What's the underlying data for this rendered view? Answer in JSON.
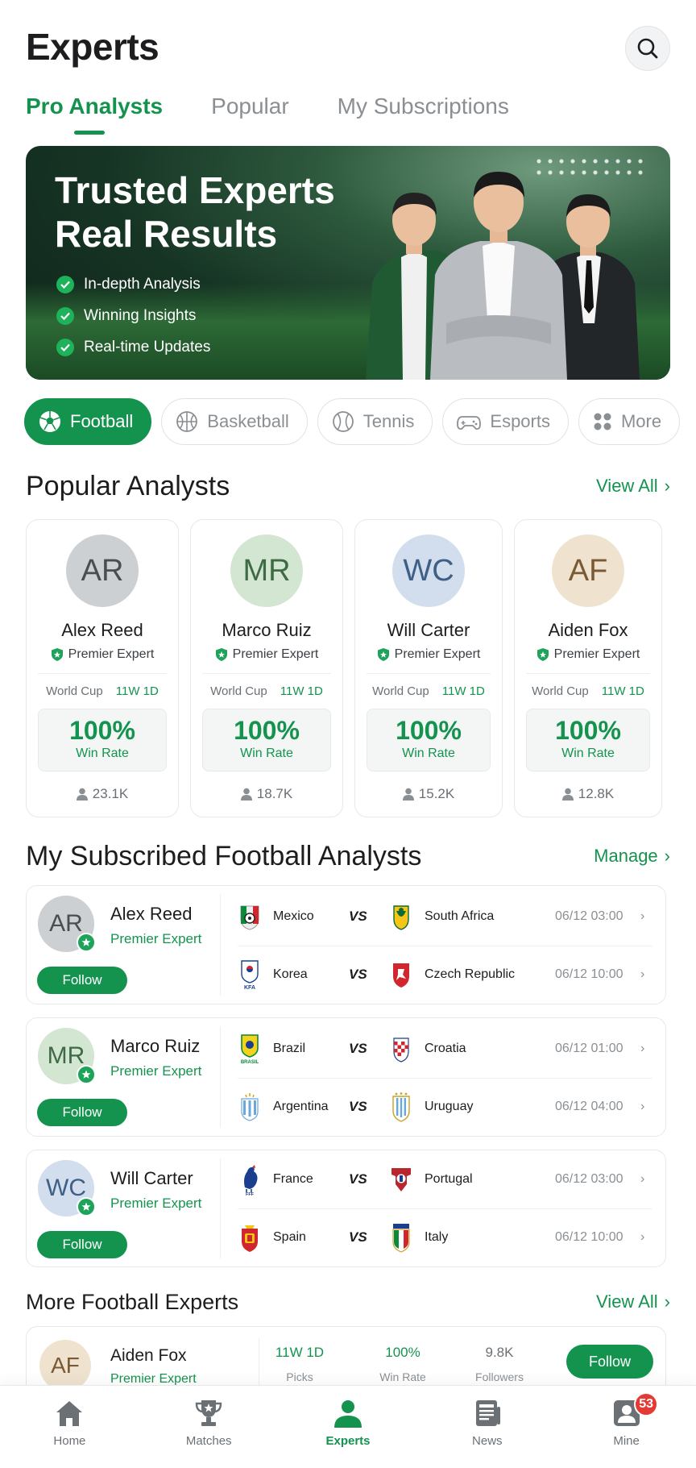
{
  "header": {
    "title": "Experts"
  },
  "tabs": [
    {
      "label": "Pro Analysts",
      "active": true
    },
    {
      "label": "Popular",
      "active": false
    },
    {
      "label": "My Subscriptions",
      "active": false
    }
  ],
  "banner": {
    "title_line1": "Trusted Experts",
    "title_line2": "Real Results",
    "bullets": [
      "In-depth Analysis",
      "Winning Insights",
      "Real-time Updates"
    ]
  },
  "sports": [
    {
      "label": "Football",
      "icon": "soccer-ball-icon",
      "active": true
    },
    {
      "label": "Basketball",
      "icon": "basketball-icon",
      "active": false
    },
    {
      "label": "Tennis",
      "icon": "tennis-ball-icon",
      "active": false
    },
    {
      "label": "Esports",
      "icon": "gamepad-icon",
      "active": false
    },
    {
      "label": "More",
      "icon": "grid-icon",
      "active": false
    }
  ],
  "popular": {
    "title": "Popular Analysts",
    "link": "View All",
    "analysts": [
      {
        "initials": "AR",
        "name": "Alex Reed",
        "role": "Premier Expert",
        "league": "World Cup",
        "record": "11W 1D",
        "win_rate": "100%",
        "win_label": "Win Rate",
        "followers": "23.1K"
      },
      {
        "initials": "MR",
        "name": "Marco Ruiz",
        "role": "Premier Expert",
        "league": "World Cup",
        "record": "11W 1D",
        "win_rate": "100%",
        "win_label": "Win Rate",
        "followers": "18.7K"
      },
      {
        "initials": "WC",
        "name": "Will Carter",
        "role": "Premier Expert",
        "league": "World Cup",
        "record": "11W 1D",
        "win_rate": "100%",
        "win_label": "Win Rate",
        "followers": "15.2K"
      },
      {
        "initials": "AF",
        "name": "Aiden Fox",
        "role": "Premier Expert",
        "league": "World Cup",
        "record": "11W 1D",
        "win_rate": "100%",
        "win_label": "Win Rate",
        "followers": "12.8K"
      }
    ]
  },
  "subscribed": {
    "title": "My Subscribed Football Analysts",
    "link": "Manage",
    "follow_label": "Follow",
    "vs_label": "VS",
    "analysts": [
      {
        "initials": "AR",
        "name": "Alex Reed",
        "role": "Premier Expert",
        "matches": [
          {
            "home": "Mexico",
            "away": "South Africa",
            "time": "06/12 03:00"
          },
          {
            "home": "Korea",
            "away": "Czech Republic",
            "time": "06/12 10:00"
          }
        ]
      },
      {
        "initials": "MR",
        "name": "Marco Ruiz",
        "role": "Premier Expert",
        "matches": [
          {
            "home": "Brazil",
            "away": "Croatia",
            "time": "06/12 01:00"
          },
          {
            "home": "Argentina",
            "away": "Uruguay",
            "time": "06/12 04:00"
          }
        ]
      },
      {
        "initials": "WC",
        "name": "Will Carter",
        "role": "Premier Expert",
        "matches": [
          {
            "home": "France",
            "away": "Portugal",
            "time": "06/12 03:00"
          },
          {
            "home": "Spain",
            "away": "Italy",
            "time": "06/12 10:00"
          }
        ]
      }
    ]
  },
  "more_experts": {
    "title": "More Football Experts",
    "link": "View All",
    "expert": {
      "initials": "AF",
      "name": "Aiden Fox",
      "role": "Premier Expert",
      "picks": "11W 1D",
      "picks_label": "Picks",
      "win_rate": "100%",
      "win_label": "Win Rate",
      "followers": "9.8K",
      "followers_label": "Followers",
      "follow_label": "Follow"
    }
  },
  "nav": {
    "items": [
      {
        "label": "Home",
        "icon": "home-icon"
      },
      {
        "label": "Matches",
        "icon": "trophy-icon"
      },
      {
        "label": "Experts",
        "icon": "person-icon",
        "active": true
      },
      {
        "label": "News",
        "icon": "news-icon"
      },
      {
        "label": "Mine",
        "icon": "profile-icon",
        "badge": "53"
      }
    ]
  },
  "colors": {
    "accent": "#14934f",
    "badge": "#e53935"
  }
}
